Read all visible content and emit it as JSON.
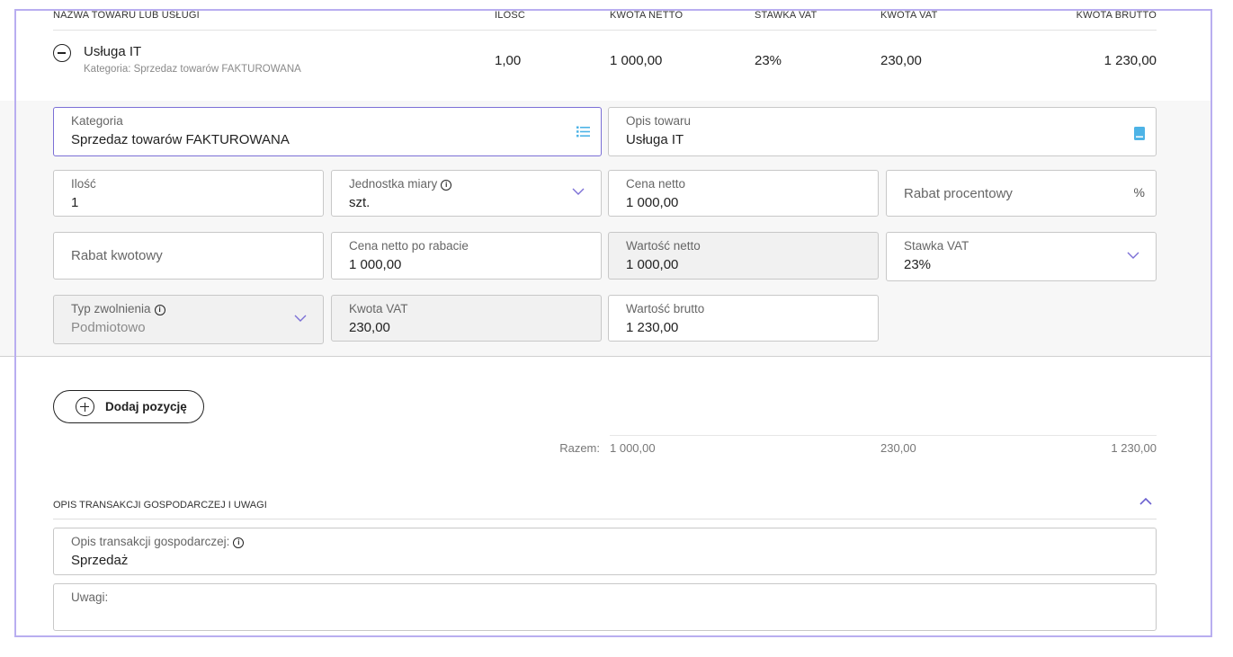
{
  "table": {
    "headers": [
      "Nazwa towaru lub usługi",
      "Ilość",
      "Kwota netto",
      "Stawka VAT",
      "Kwota VAT",
      "Kwota brutto"
    ],
    "item": {
      "name": "Usługa IT",
      "category": "Kategoria: Sprzedaz towarów FAKTUROWANA",
      "qty": "1,00",
      "net": "1 000,00",
      "vat_rate": "23%",
      "vat_amount": "230,00",
      "gross": "1 230,00"
    }
  },
  "form": {
    "kategoria": {
      "label": "Kategoria",
      "value": "Sprzedaz towarów FAKTUROWANA"
    },
    "opis_towaru": {
      "label": "Opis towaru",
      "value": "Usługa IT"
    },
    "ilosc": {
      "label": "Ilość",
      "value": "1"
    },
    "jednostka": {
      "label": "Jednostka miary",
      "value": "szt."
    },
    "cena_netto": {
      "label": "Cena netto",
      "value": "1 000,00"
    },
    "rabat_procentowy": {
      "placeholder": "Rabat procentowy",
      "suffix": "%"
    },
    "rabat_kwotowy": {
      "placeholder": "Rabat kwotowy"
    },
    "cena_po_rabacie": {
      "label": "Cena netto po rabacie",
      "value": "1 000,00"
    },
    "wartosc_netto": {
      "label": "Wartość netto",
      "value": "1 000,00"
    },
    "stawka_vat": {
      "label": "Stawka VAT",
      "value": "23%"
    },
    "typ_zwolnienia": {
      "label": "Typ zwolnienia",
      "value": "Podmiotowo"
    },
    "kwota_vat": {
      "label": "Kwota VAT",
      "value": "230,00"
    },
    "wartosc_brutto": {
      "label": "Wartość brutto",
      "value": "1 230,00"
    }
  },
  "add_button": "Dodaj pozycję",
  "totals": {
    "label": "Razem:",
    "net": "1 000,00",
    "vat": "230,00",
    "gross": "1 230,00"
  },
  "section": {
    "title": "Opis transakcji gospodarczej i uwagi",
    "opis_transakcji": {
      "label": "Opis transakcji gospodarczej:",
      "value": "Sprzedaż"
    },
    "uwagi": {
      "label": "Uwagi:",
      "value": ""
    }
  },
  "colors": {
    "accent": "#7b6fd6",
    "icon_blue": "#4db3e6",
    "frame": "#b9aef0"
  }
}
